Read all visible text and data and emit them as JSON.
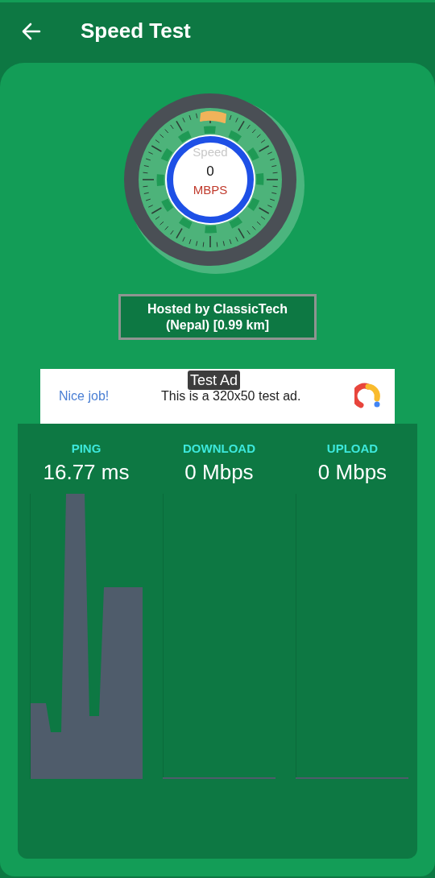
{
  "app_bar": {
    "title": "Speed Test"
  },
  "gauge": {
    "label": "Speed",
    "value": "0",
    "unit": "MBPS"
  },
  "server": {
    "text": "Hosted by ClassicTech (Nepal) [0.99 km]"
  },
  "ad": {
    "badge": "Test Ad",
    "headline": "Nice job!",
    "text": "This is a 320x50 test ad."
  },
  "stats": [
    {
      "label": "PING",
      "value": "16.77 ms",
      "kind": "active"
    },
    {
      "label": "DOWNLOAD",
      "value": "0 Mbps",
      "kind": "idle"
    },
    {
      "label": "UPLOAD",
      "value": "0 Mbps",
      "kind": "idle"
    }
  ]
}
